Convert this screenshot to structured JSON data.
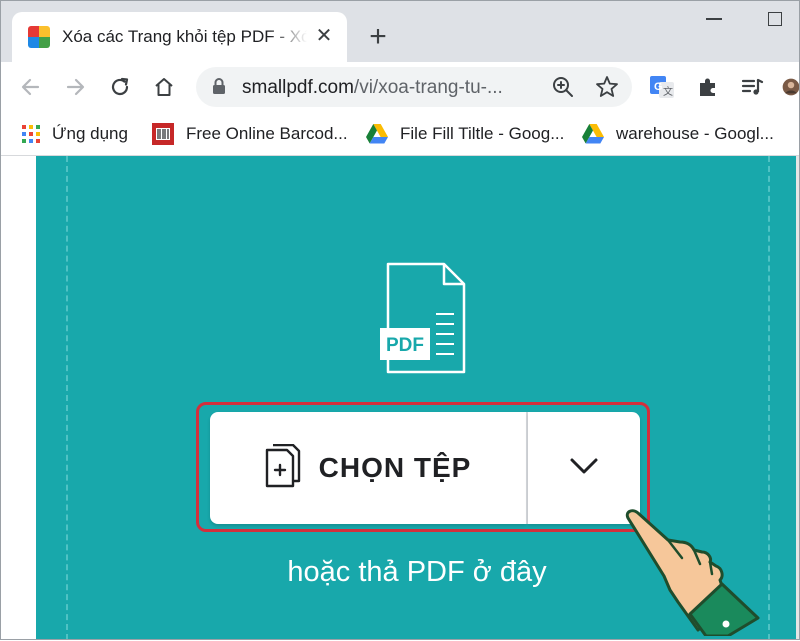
{
  "browser": {
    "tab_title": "Xóa các Trang khỏi tệp PDF - Xóa",
    "tab_close": "✕",
    "new_tab": "+",
    "url_host": "smallpdf.com",
    "url_path": "/vi/xoa-trang-tu-..."
  },
  "bookmarks": [
    {
      "label": "Ứng dụng",
      "icon": "apps-grid-icon"
    },
    {
      "label": "Free Online Barcod...",
      "icon": "barcode-favicon-icon"
    },
    {
      "label": "File Fill Tiltle - Goog...",
      "icon": "google-drive-icon"
    },
    {
      "label": "warehouse - Googl...",
      "icon": "google-drive-icon"
    }
  ],
  "page": {
    "file_badge": "PDF",
    "choose_button_label": "CHỌN TỆP",
    "drop_hint": "hoặc thả PDF ở đây"
  },
  "colors": {
    "accent": "#18a8ab",
    "highlight_border": "#d32f3c",
    "tab_strip": "#dee1e6"
  }
}
